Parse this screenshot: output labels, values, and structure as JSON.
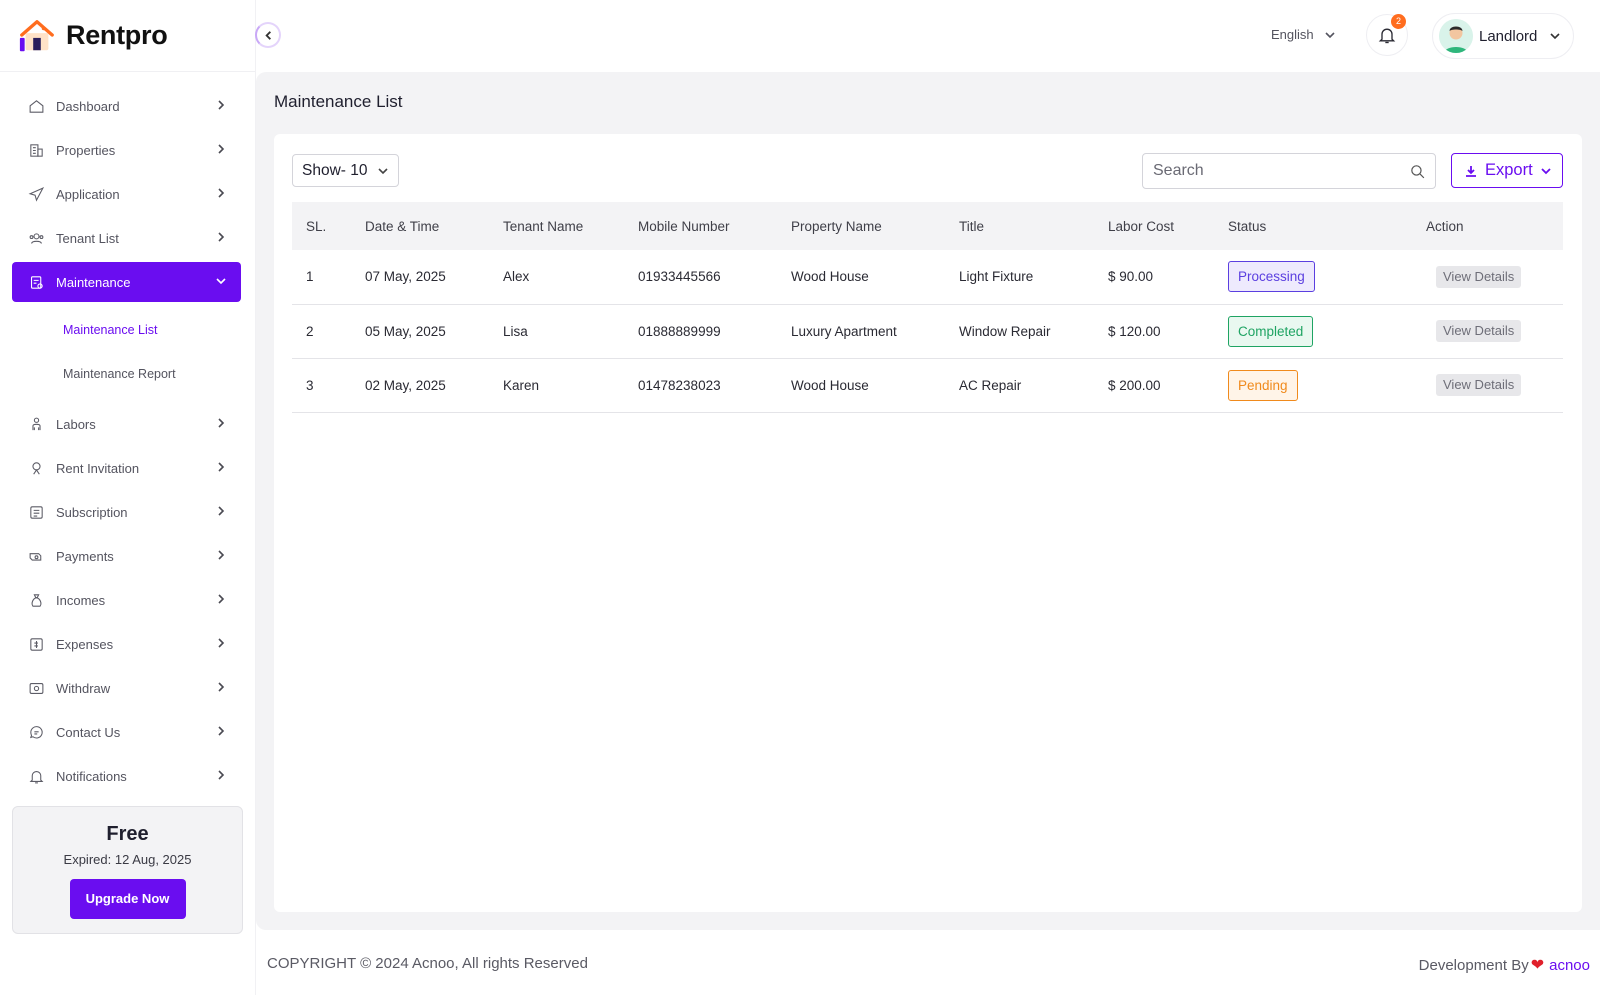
{
  "brand": {
    "name": "Rentpro"
  },
  "sidebar": {
    "items": [
      {
        "label": "Dashboard",
        "icon": "home-icon"
      },
      {
        "label": "Properties",
        "icon": "building-icon"
      },
      {
        "label": "Application",
        "icon": "send-icon"
      },
      {
        "label": "Tenant List",
        "icon": "users-icon"
      },
      {
        "label": "Maintenance",
        "icon": "clipboard-icon",
        "active": true
      },
      {
        "label": "Labors",
        "icon": "worker-icon"
      },
      {
        "label": "Rent Invitation",
        "icon": "invite-icon"
      },
      {
        "label": "Subscription",
        "icon": "subscription-icon"
      },
      {
        "label": "Payments",
        "icon": "payment-icon"
      },
      {
        "label": "Incomes",
        "icon": "money-bag-icon"
      },
      {
        "label": "Expenses",
        "icon": "expense-icon"
      },
      {
        "label": "Withdraw",
        "icon": "withdraw-icon"
      },
      {
        "label": "Contact Us",
        "icon": "chat-icon"
      },
      {
        "label": "Notifications",
        "icon": "bell-icon"
      }
    ],
    "sub_items": [
      {
        "label": "Maintenance List",
        "active": true
      },
      {
        "label": "Maintenance Report"
      }
    ],
    "plan": {
      "name": "Free",
      "expired": "Expired: 12 Aug, 2025",
      "upgrade_label": "Upgrade Now"
    }
  },
  "header": {
    "language": "English",
    "notification_count": "2",
    "user_role": "Landlord"
  },
  "main": {
    "title": "Maintenance List",
    "show_select": "Show- 10",
    "search_placeholder": "Search",
    "export_label": "Export",
    "columns": [
      "SL.",
      "Date & Time",
      "Tenant Name",
      "Mobile Number",
      "Property Name",
      "Title",
      "Labor Cost",
      "Status",
      "Action"
    ],
    "rows": [
      {
        "sl": "1",
        "date": "07 May, 2025",
        "tenant": "Alex",
        "mobile": "01933445566",
        "property": "Wood House",
        "title": "Light Fixture",
        "cost": "$ 90.00",
        "status": "Processing",
        "action": "View Details"
      },
      {
        "sl": "2",
        "date": "05 May, 2025",
        "tenant": "Lisa",
        "mobile": "01888889999",
        "property": "Luxury Apartment",
        "title": "Window Repair",
        "cost": "$ 120.00",
        "status": "Completed",
        "action": "View Details"
      },
      {
        "sl": "3",
        "date": "02 May, 2025",
        "tenant": "Karen",
        "mobile": "01478238023",
        "property": "Wood House",
        "title": "AC Repair",
        "cost": "$ 200.00",
        "status": "Pending",
        "action": "View Details"
      }
    ]
  },
  "footer": {
    "copyright": "COPYRIGHT © 2024 Acnoo, All rights Reserved",
    "dev_by": "Development By",
    "dev_brand": "acnoo"
  },
  "colors": {
    "accent": "#6a0df0",
    "processing": "#5b3fe0",
    "completed": "#1fa463",
    "pending": "#f08a1c",
    "badge_notification": "#ff6d1f"
  }
}
